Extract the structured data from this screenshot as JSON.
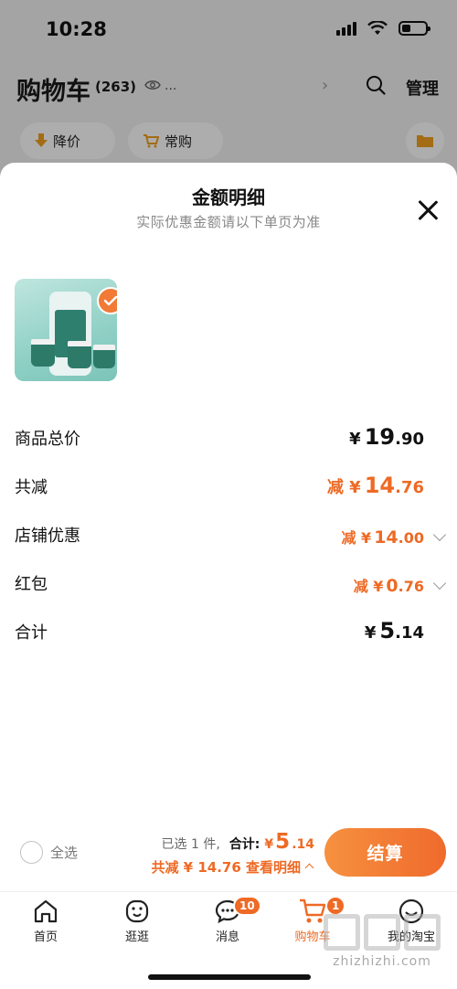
{
  "status_bar": {
    "time": "10:28"
  },
  "cart": {
    "title": "购物车",
    "count": "(263)",
    "address_hint": "...",
    "manage_label": "管理"
  },
  "filters": {
    "price_drop": "降价",
    "frequent": "常购"
  },
  "sheet": {
    "title": "金额明细",
    "subtitle": "实际优惠金额请以下单页为准"
  },
  "breakdown": {
    "subtotal": {
      "label": "商品总价",
      "prefix": "¥",
      "int": "19",
      "dec": ".90"
    },
    "total_discount": {
      "label": "共减",
      "prefix": "减 ¥",
      "int": "14",
      "dec": ".76"
    },
    "store_discount": {
      "label": "店铺优惠",
      "prefix": "减 ¥",
      "int": "14",
      "dec": ".00"
    },
    "red_packet": {
      "label": "红包",
      "prefix": "减 ¥",
      "int": "0",
      "dec": ".76"
    },
    "total": {
      "label": "合计",
      "prefix": "¥",
      "int": "5",
      "dec": ".14"
    }
  },
  "checkout": {
    "select_all": "全选",
    "selected_count": "已选 1 件,",
    "total_label": "合计:",
    "currency": "¥",
    "total_int": "5",
    "total_dec": ".14",
    "discount_text": "共减 ¥ 14.76  查看明细",
    "button": "结算"
  },
  "tabs": [
    {
      "label": "首页"
    },
    {
      "label": "逛逛"
    },
    {
      "label": "消息",
      "badge": "10"
    },
    {
      "label": "购物车",
      "badge": "1"
    },
    {
      "label": "我的淘宝"
    }
  ],
  "watermark": {
    "text": "zhizhizhi.com"
  },
  "colors": {
    "accent": "#ee6a25",
    "overlay": "rgba(0,0,0,0.32)"
  }
}
